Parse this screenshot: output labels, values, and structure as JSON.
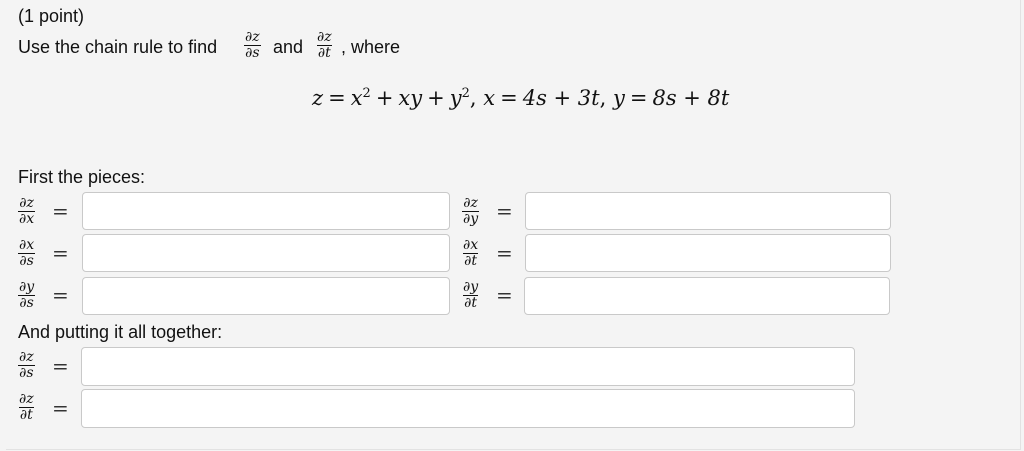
{
  "header": {
    "points": "(1 point)"
  },
  "prompt": {
    "part1": "Use the chain rule to find",
    "and": "and",
    "where": ", where"
  },
  "prompt_fracs": [
    {
      "num": "∂z",
      "den": "∂s"
    },
    {
      "num": "∂z",
      "den": "∂t"
    }
  ],
  "formula": {
    "z": "z",
    "x": "x",
    "y": "y",
    "xy": "xy",
    "two": "2",
    "x_def": "4s + 3t",
    "y_def": "8s + 8t"
  },
  "section1": {
    "title": "First the pieces:"
  },
  "pieces": [
    {
      "num": "∂z",
      "den": "∂x",
      "value": ""
    },
    {
      "num": "∂z",
      "den": "∂y",
      "value": ""
    },
    {
      "num": "∂x",
      "den": "∂s",
      "value": ""
    },
    {
      "num": "∂x",
      "den": "∂t",
      "value": ""
    },
    {
      "num": "∂y",
      "den": "∂s",
      "value": ""
    },
    {
      "num": "∂y",
      "den": "∂t",
      "value": ""
    }
  ],
  "section2": {
    "title": "And putting it all together:"
  },
  "together": [
    {
      "num": "∂z",
      "den": "∂s",
      "value": ""
    },
    {
      "num": "∂z",
      "den": "∂t",
      "value": ""
    }
  ],
  "equals": "="
}
